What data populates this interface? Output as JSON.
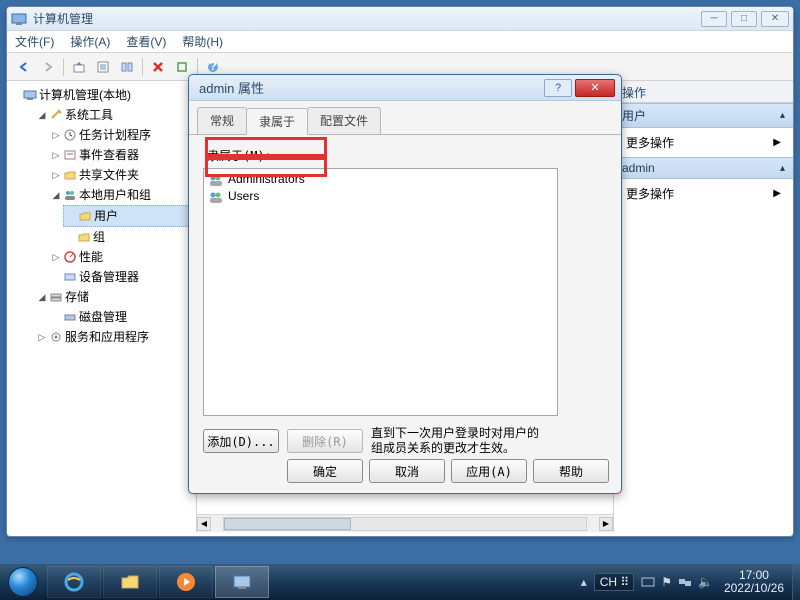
{
  "window": {
    "title": "计算机管理",
    "menu": {
      "file": "文件(F)",
      "action": "操作(A)",
      "view": "查看(V)",
      "help": "帮助(H)"
    }
  },
  "tree": {
    "root": "计算机管理(本地)",
    "system_tools": "系统工具",
    "task_scheduler": "任务计划程序",
    "event_viewer": "事件查看器",
    "shared_folders": "共享文件夹",
    "local_users": "本地用户和组",
    "users": "用户",
    "groups": "组",
    "performance": "性能",
    "device_manager": "设备管理器",
    "storage": "存储",
    "disk_management": "磁盘管理",
    "services": "服务和应用程序"
  },
  "actions": {
    "header": "操作",
    "section_user": "用户",
    "section_admin": "admin",
    "more": "更多操作"
  },
  "dialog": {
    "title": "admin 属性",
    "tabs": {
      "general": "常规",
      "memberof": "隶属于",
      "profile": "配置文件"
    },
    "memberof_label": "隶属于(M):",
    "groups": [
      "Administrators",
      "Users"
    ],
    "add": "添加(D)...",
    "remove": "删除(R)",
    "hint": "直到下一次用户登录时对用户的组成员关系的更改才生效。",
    "ok": "确定",
    "cancel": "取消",
    "apply": "应用(A)",
    "help": "帮助"
  },
  "taskbar": {
    "lang": "CH",
    "time": "17:00",
    "date": "2022/10/26"
  }
}
